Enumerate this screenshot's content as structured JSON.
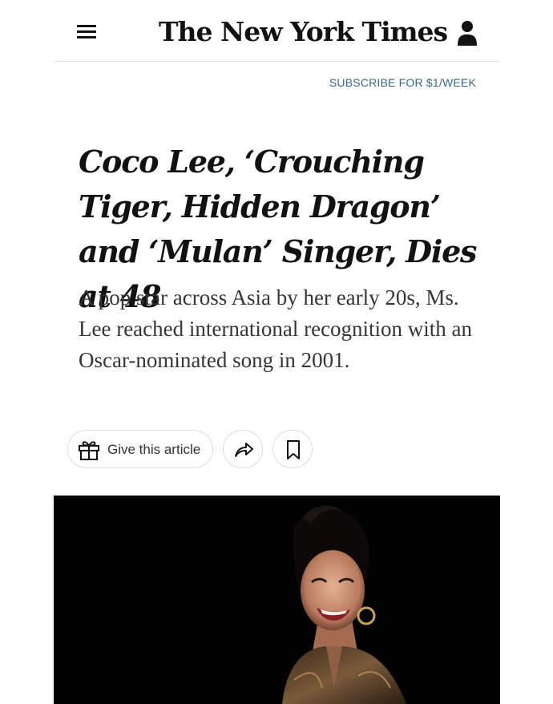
{
  "header": {
    "masthead": "The New York Times",
    "menu_icon": "hamburger-menu-icon",
    "account_icon": "user-account-icon"
  },
  "subscribe": {
    "label": "SUBSCRIBE FOR $1/WEEK"
  },
  "article": {
    "headline": "Coco Lee, ‘Crouching Tiger, Hidden Dragon’ and ‘Mulan’ Singer, Dies at 48",
    "summary": "A pop star across Asia by her early 20s, Ms. Lee reached international recognition with an Oscar-nominated song in 2001."
  },
  "actions": {
    "gift_label": "Give this article",
    "gift_icon": "gift-icon",
    "share_icon": "share-icon",
    "save_icon": "bookmark-icon"
  },
  "photo": {
    "alt_icon": "article-photo"
  },
  "colors": {
    "text": "#121212",
    "link": "#326891",
    "photo_background": "#020202"
  }
}
